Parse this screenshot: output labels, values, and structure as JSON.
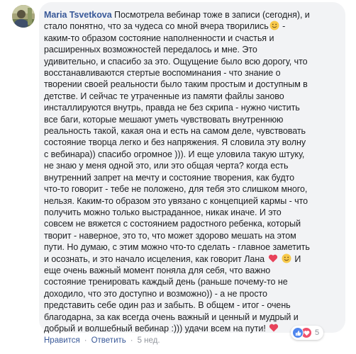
{
  "comment": {
    "author": "Maria Tsvetkova",
    "lines": [
      " Посмотрела вебинар тоже в записи (сегодня), и",
      "стало понятно, что за чудеса со мной вчера творились",
      "каким-то образом состояние наполненности и счастья и",
      "расширенных возможностей передалось и мне. Это",
      "удивительно, и спасибо за это. Ощущение было всю дорогу, что",
      "восстанавливаются стертые воспоминания - что знание о",
      "творении своей реальности было таким простым и доступным в",
      "детстве. И сейчас те утраченные из памяти файлы заново",
      "инсталлируются внутрь, правда не без скрипа - нужно чистить",
      "все баги, которые мешают уметь чувствовать внутреннюю",
      "реальность такой, какая она и есть на самом деле, чувствовать",
      "состояние творца легко и без напряжения. Я словила эту волну",
      "с вебинара)) спасибо огромное ))). И еще уловила такую штуку,",
      "не знаю у меня одной это, или это общая черта? когда есть",
      "внутренний запрет на мечту и состояние творения, как будто",
      "что-то говорит - тебе не положено, для тебя это слишком много,",
      "нельзя. Каким-то образом это увязано с концепцией кармы - что",
      "получить можно только выстраданное, никак иначе. И это",
      "совсем не вяжется с состоянием радостного ребенка, который",
      "творит - наверное, это то, что может здорово мешать на этом",
      "пути. Но думаю, с этим можно что-то сделать - главное заметить",
      "и осознать, и это начало исцеления, как говорит Лана",
      "еще очень важный момент поняла для себя, что важно",
      "состояние тренировать каждый день (раньше почему-то не",
      "доходило, что это доступно и возможно)) - а не просто",
      "представить себе один раз и забыть. В общем - итог - очень",
      "благодарна, за как всегда очень важный и ценный и мудрый и",
      "добрый и волшебный вебинар :))) удачи всем на пути!"
    ],
    "line2_tail": " -",
    "line22_tail": " И"
  },
  "reactions": {
    "icons": [
      "like-icon",
      "heart-icon"
    ],
    "count": "5",
    "colors": {
      "like": "#4f86ee",
      "love": "#f0516c"
    }
  },
  "actions": {
    "like_label": "Нравится",
    "reply_label": "Ответить",
    "timestamp": "5 нед."
  },
  "colors": {
    "author": "#385898",
    "bubble": "#f2f3f5",
    "meta": "#90949c"
  }
}
